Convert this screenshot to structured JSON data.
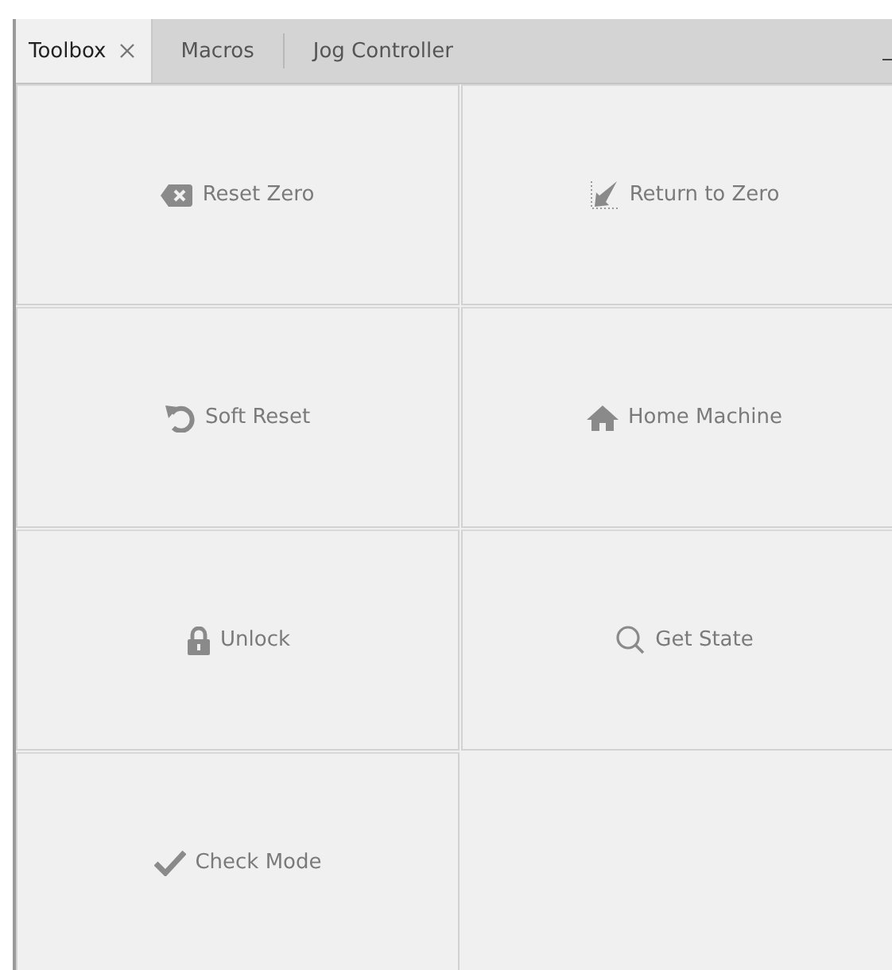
{
  "tabs": [
    {
      "label": "Toolbox",
      "selected": true,
      "closable": true
    },
    {
      "label": "Macros",
      "selected": false,
      "closable": false
    },
    {
      "label": "Jog Controller",
      "selected": false,
      "closable": false
    }
  ],
  "buttons": [
    {
      "label": "Reset Zero"
    },
    {
      "label": "Return to Zero"
    },
    {
      "label": "Soft Reset"
    },
    {
      "label": "Home Machine"
    },
    {
      "label": "Unlock"
    },
    {
      "label": "Get State"
    },
    {
      "label": "Check Mode"
    }
  ]
}
